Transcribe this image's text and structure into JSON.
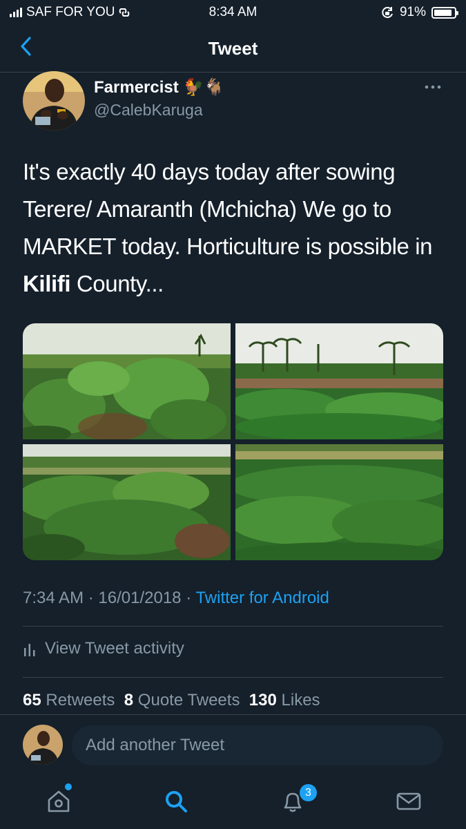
{
  "status_bar": {
    "carrier": "SAF FOR YOU",
    "time": "8:34 AM",
    "battery": "91%",
    "battery_level": 0.91
  },
  "nav": {
    "title": "Tweet"
  },
  "author": {
    "name": "Farmercist",
    "name_emoji": "🐓🐐",
    "handle": "@CalebKaruga"
  },
  "tweet": {
    "text_part1": "It's exactly 40 days today after sowing Terere/ Amaranth  (Mchicha) We go to MARKET today. Horticulture is possible in ",
    "text_bold": "Kilifi",
    "text_part2": " County...",
    "photos": [
      "amaranth field photo 1",
      "amaranth field photo 2",
      "amaranth field photo 3",
      "amaranth field photo 4"
    ]
  },
  "meta": {
    "time": "7:34 AM",
    "date": "16/01/2018",
    "separator": "·",
    "source": "Twitter for Android"
  },
  "activity": {
    "label": "View Tweet activity"
  },
  "stats": {
    "retweets_count": "65",
    "retweets_label": "Retweets",
    "quotes_count": "8",
    "quotes_label": "Quote Tweets",
    "likes_count": "130",
    "likes_label": "Likes"
  },
  "reply": {
    "placeholder": "Add another Tweet"
  },
  "tab_bar": {
    "notifications_badge": "3",
    "icons": [
      "home-icon",
      "search-icon",
      "notifications-icon",
      "messages-icon"
    ]
  },
  "colors": {
    "background": "#15202b",
    "accent": "#1da1f2",
    "secondary_text": "#8899a6",
    "divider": "#38444d"
  }
}
